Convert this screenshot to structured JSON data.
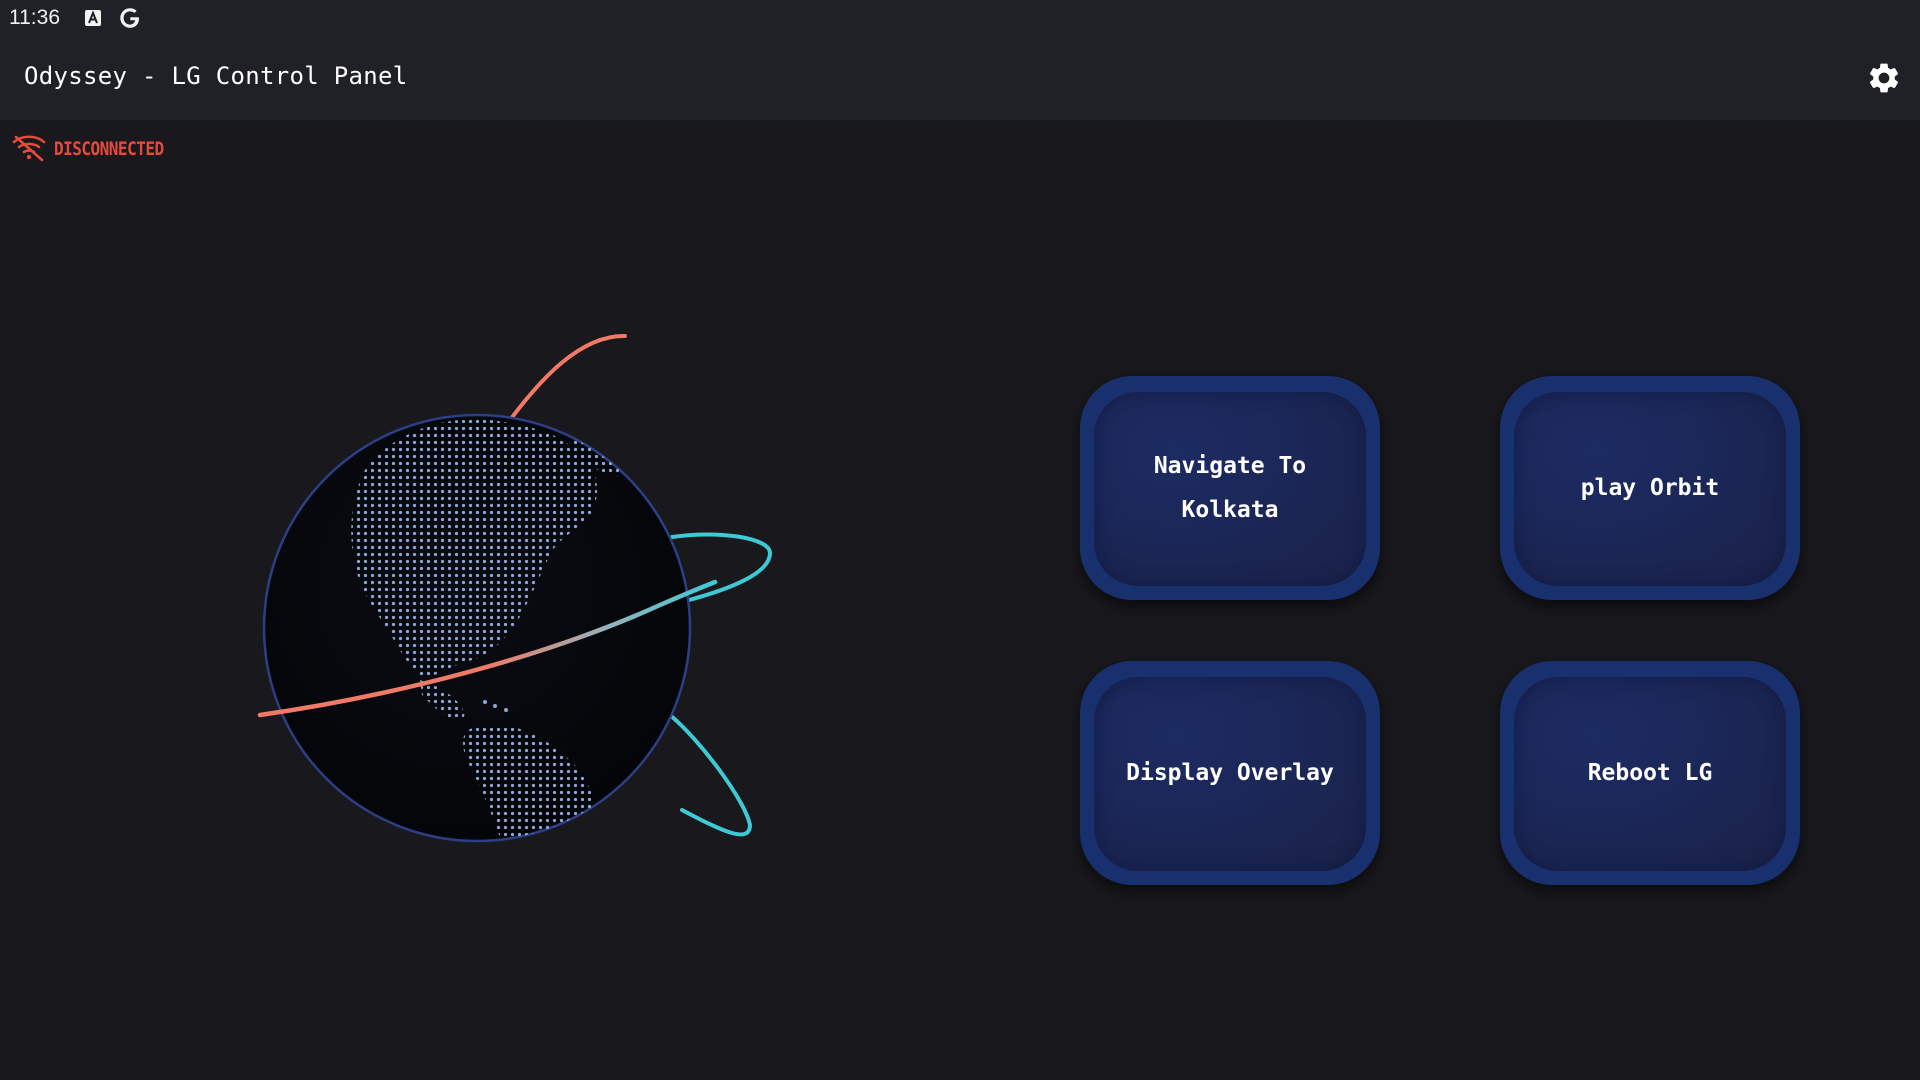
{
  "status_bar": {
    "time": "11:36",
    "icons": [
      "a-notification-icon",
      "google-icon"
    ]
  },
  "app_bar": {
    "title": "Odyssey - LG Control Panel",
    "settings_icon": "gear-icon"
  },
  "connection": {
    "status_label": "DISCONNECTED",
    "icon": "wifi-off-icon",
    "color": "#e8493d"
  },
  "globe": {
    "orbit_colors": [
      "#f07a66",
      "#3ec9d6"
    ]
  },
  "actions": [
    {
      "label": "Navigate To\nKolkata"
    },
    {
      "label": "play Orbit"
    },
    {
      "label": "Display Overlay"
    },
    {
      "label": "Reboot LG"
    }
  ],
  "colors": {
    "background": "#18181d",
    "app_bar": "#202127",
    "button": "#19306e"
  }
}
